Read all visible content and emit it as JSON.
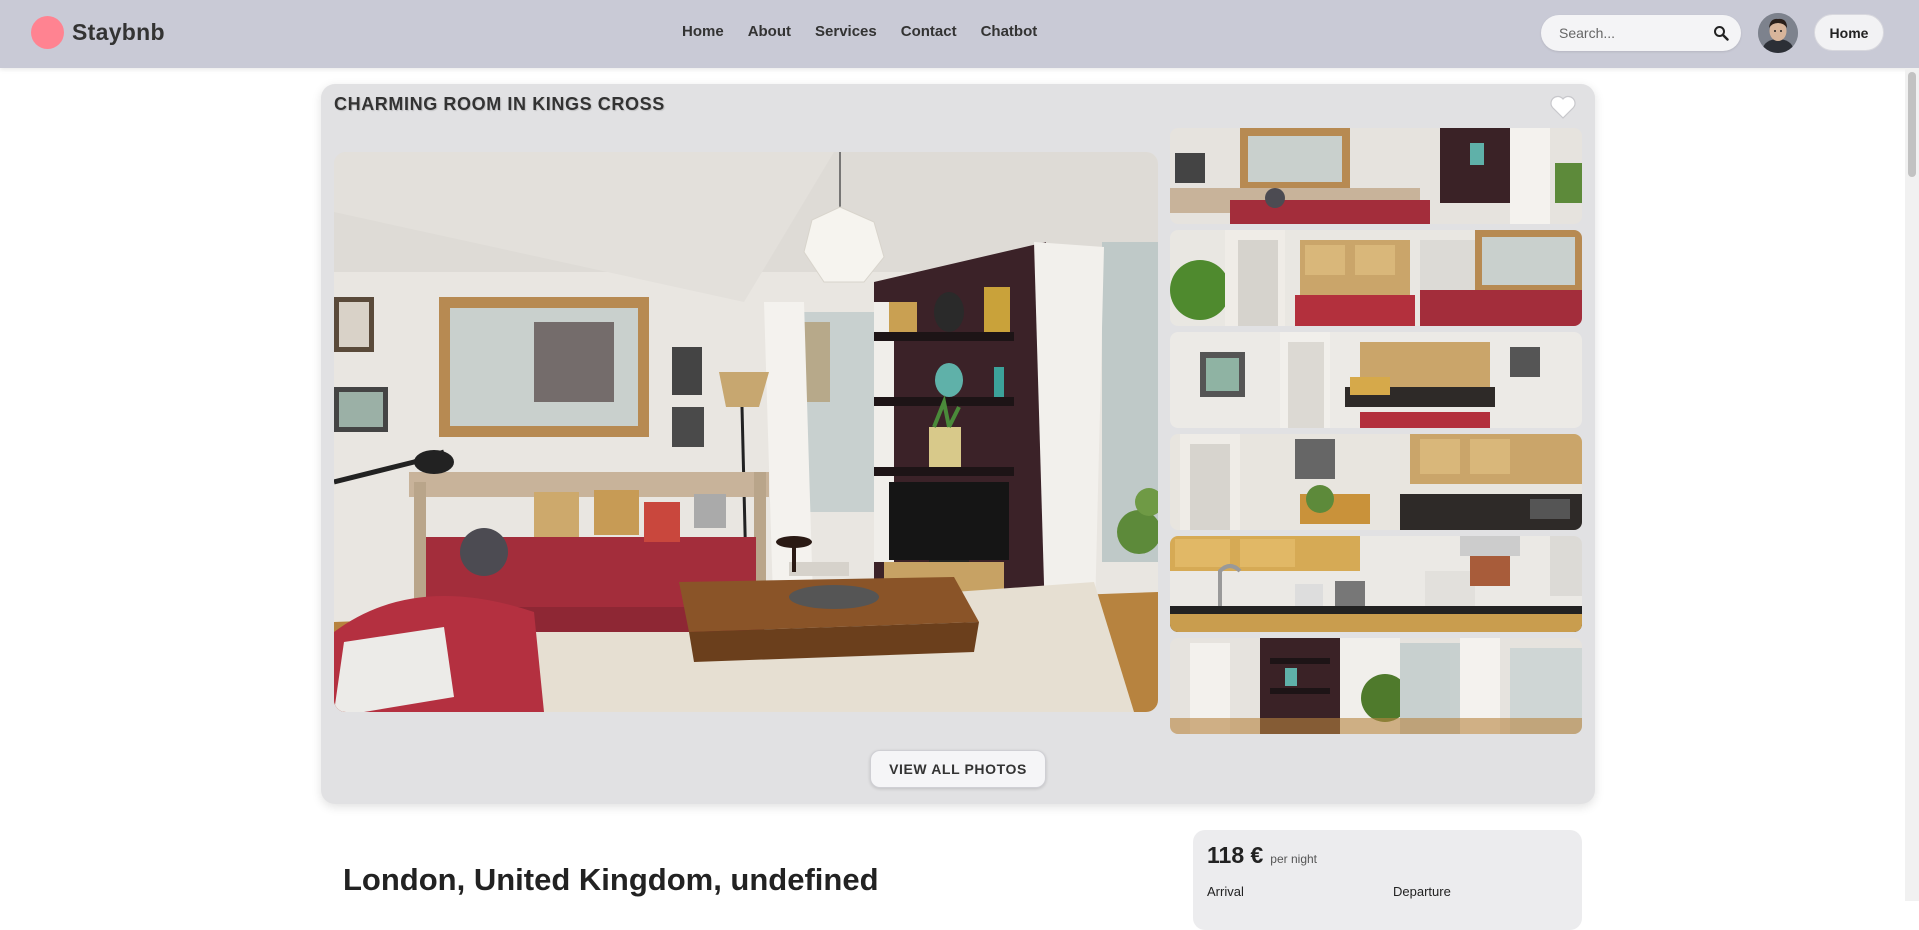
{
  "header": {
    "brand": "Staybnb",
    "nav": [
      "Home",
      "About",
      "Services",
      "Contact",
      "Chatbot"
    ],
    "search_placeholder": "Search...",
    "home_button": "Home",
    "icons": {
      "search": "search-icon",
      "avatar": "user-avatar"
    }
  },
  "listing": {
    "title": "CHARMING ROOM IN KINGS CROSS",
    "view_all_label": "VIEW ALL PHOTOS",
    "location": "London, United Kingdom, undefined",
    "thumbnail_count": 6
  },
  "booking": {
    "price": "118 €",
    "per_night": "per night",
    "arrival_label": "Arrival",
    "departure_label": "Departure"
  },
  "colors": {
    "header_bg": "#c9cad6",
    "logo_accent": "#ff8391",
    "card_bg": "#e1e1e3"
  }
}
